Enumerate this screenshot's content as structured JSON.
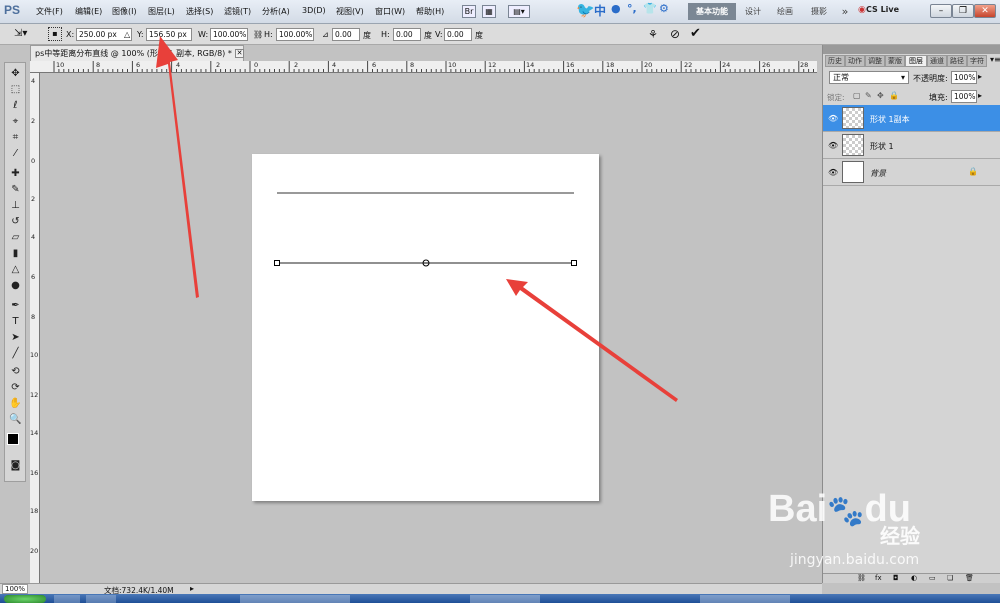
{
  "app": {
    "logo": "PS"
  },
  "menu": [
    "文件(F)",
    "编辑(E)",
    "图像(I)",
    "图层(L)",
    "选择(S)",
    "滤镜(T)",
    "分析(A)",
    "3D(D)",
    "视图(V)",
    "窗口(W)",
    "帮助(H)"
  ],
  "ime": {
    "label": "中"
  },
  "workspace": {
    "active": "基本功能",
    "items": [
      "设计",
      "绘画",
      "摄影"
    ],
    "more": "»",
    "cs_live": "CS Live"
  },
  "options": {
    "x_label": "X:",
    "x_value": "250.00 px",
    "y_label": "Y:",
    "y_value": "156.50 px",
    "w_label": "W:",
    "w_value": "100.00%",
    "h_label": "H:",
    "h_value": "100.00%",
    "angle_value": "0.00",
    "angle_unit": "度",
    "hskew_label": "H:",
    "hskew_value": "0.00",
    "hskew_unit": "度",
    "vskew_label": "V:",
    "vskew_value": "0.00",
    "vskew_unit": "度"
  },
  "document": {
    "tab_title": "ps中等距离分布直线 @ 100% (形状 1 副本, RGB/8) *"
  },
  "rulers": {
    "h_ticks": [
      "10",
      "8",
      "6",
      "4",
      "2",
      "0",
      "2",
      "4",
      "6",
      "8",
      "10",
      "12",
      "14",
      "16",
      "18",
      "20",
      "22",
      "24",
      "26",
      "28"
    ],
    "v_ticks": [
      "4",
      "2",
      "0",
      "2",
      "4",
      "6",
      "8",
      "10",
      "12",
      "14",
      "16",
      "18",
      "20"
    ]
  },
  "layers_panel": {
    "tabs": [
      "历史",
      "动作",
      "调整",
      "蒙版",
      "图层",
      "通道",
      "路径",
      "字符"
    ],
    "active_tab": "图层",
    "blend_mode": "正常",
    "opacity_label": "不透明度:",
    "opacity_value": "100%",
    "lock_label": "锁定:",
    "fill_label": "填充:",
    "fill_value": "100%",
    "layers": [
      {
        "name": "形状 1副本",
        "selected": true
      },
      {
        "name": "形状 1",
        "selected": false
      },
      {
        "name": "背景",
        "selected": false
      }
    ]
  },
  "status": {
    "zoom": "100%",
    "doc_info": "文档:732.4K/1.40M"
  },
  "watermark": {
    "brand": "Bai",
    "brand2": "du",
    "cn": "经验",
    "url": "jingyan.baidu.com"
  },
  "colors": {
    "selected_layer": "#3c8fe6",
    "annotation_arrow": "#e8403a",
    "canvas_bg": "#c2c2c2"
  }
}
